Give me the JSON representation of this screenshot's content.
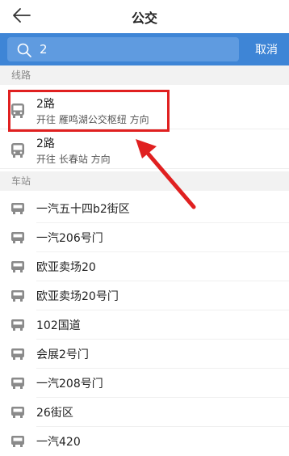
{
  "header": {
    "title": "公交"
  },
  "search": {
    "value": "2",
    "cancel_label": "取消"
  },
  "sections": {
    "routes": "线路",
    "stations": "车站"
  },
  "routes": [
    {
      "name": "2路",
      "direction": "开往 雁鸣湖公交枢纽 方向"
    },
    {
      "name": "2路",
      "direction": "开往 长春站 方向"
    }
  ],
  "stations": [
    "一汽五十四b2街区",
    "一汽206号门",
    "欧亚卖场20",
    "欧亚卖场20号门",
    "102国道",
    "会展2号门",
    "一汽208号门",
    "26街区",
    "一汽420"
  ],
  "colors": {
    "accent": "#3e85d6",
    "highlight": "#e02020",
    "icon": "#8a8a8a"
  }
}
